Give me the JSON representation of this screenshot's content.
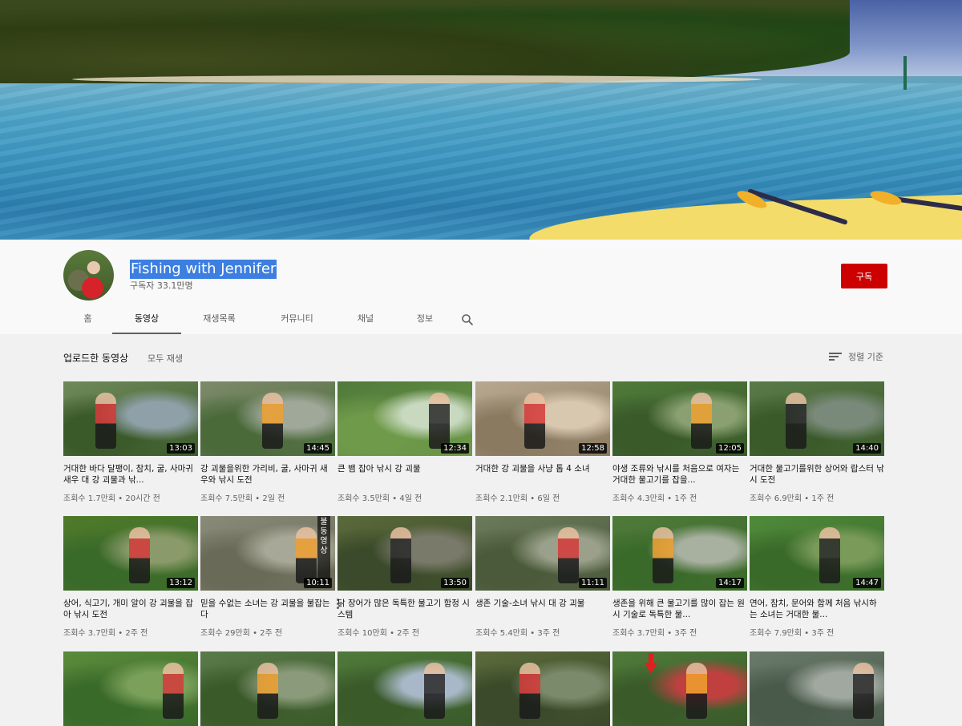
{
  "channel": {
    "name": "Fishing with Jennifer",
    "subscribers": "구독자 33.1만명",
    "subscribe_label": "구독"
  },
  "tabs": [
    {
      "label": "홈",
      "active": false
    },
    {
      "label": "동영상",
      "active": true
    },
    {
      "label": "재생목록",
      "active": false
    },
    {
      "label": "커뮤니티",
      "active": false
    },
    {
      "label": "채널",
      "active": false
    },
    {
      "label": "정보",
      "active": false
    }
  ],
  "section": {
    "title": "업로드한 동영상",
    "play_all": "모두 재생",
    "sort_label": "정렬 기준"
  },
  "videos": [
    {
      "title": "거대한 바다 달팽이, 참치, 굴, 사마귀 새우 대 강 괴물과 낚...",
      "meta": "조회수 1.7만회 • 20시간 전",
      "duration": "13:03",
      "colors": [
        "#6f8a5a",
        "#8fa0a8",
        "#3b5a2a"
      ]
    },
    {
      "title": "강 괴물을위한 가리비, 굴, 사마귀 새우와 낚시 도전",
      "meta": "조회수 7.5만회 • 2일 전",
      "duration": "14:45",
      "colors": [
        "#7d8a6a",
        "#a0a89a",
        "#4a6a3a"
      ]
    },
    {
      "title": "큰 뱀 잡아 낚시 강 괴물",
      "meta": "조회수 3.5만회 • 4일 전",
      "duration": "12:34",
      "colors": [
        "#4f7a3a",
        "#c9d9c0",
        "#6f9a4a"
      ]
    },
    {
      "title": "거대한 강 괴물을 사냥 톱 4 소녀",
      "meta": "조회수 2.1만회 • 6일 전",
      "duration": "12:58",
      "colors": [
        "#b8a890",
        "#d9c8b0",
        "#8a7a60"
      ]
    },
    {
      "title": "야생 조류와 낚시를 처음으로 여자는 거대한 물고기를 잡을...",
      "meta": "조회수 4.3만회 • 1주 전",
      "duration": "12:05",
      "colors": [
        "#4f7a3a",
        "#8aa070",
        "#3a5a2a"
      ]
    },
    {
      "title": "거대한 물고기를위한 상어와 랍스터 낚시 도전",
      "meta": "조회수 6.9만회 • 1주 전",
      "duration": "14:40",
      "colors": [
        "#5a7a4a",
        "#7a8a7a",
        "#3a5a2a"
      ]
    },
    {
      "title": "상어, 식고기, 개미 알이 강 괴물을 잡아 낚시 도전",
      "meta": "조회수 3.7만회 • 2주 전",
      "duration": "13:12",
      "colors": [
        "#4f7a2a",
        "#8a9a6a",
        "#3a6a2a"
      ]
    },
    {
      "title": "믿을 수없는 소녀는 강 괴물을 불잡는다",
      "meta": "조회수 29만회 • 2주 전",
      "duration": "10:11",
      "colors": [
        "#8a8a78",
        "#a8a898",
        "#6a6a58"
      ],
      "overlay_text": "불동영상"
    },
    {
      "title": "닭 장어가 많은 독특한 물고기 함정 시스템",
      "meta": "조회수 10만회 • 2주 전",
      "duration": "13:50",
      "colors": [
        "#5a6a3a",
        "#7a7a6a",
        "#3a4a2a"
      ]
    },
    {
      "title": "생존 기술-소녀 낚시 대 강 괴물",
      "meta": "조회수 5.4만회 • 3주 전",
      "duration": "11:11",
      "colors": [
        "#6a7a5a",
        "#9aa08a",
        "#4a5a3a"
      ]
    },
    {
      "title": "생존을 위해 큰 물고기를 많이 잡는 원시 기술로 독특한 물...",
      "meta": "조회수 3.7만회 • 3주 전",
      "duration": "14:17",
      "colors": [
        "#4f7a3a",
        "#a8b0a0",
        "#3a6a2a"
      ]
    },
    {
      "title": "연어, 참치, 문어와 함께 처음 낚시하는 소녀는 거대한 물...",
      "meta": "조회수 7.9만회 • 3주 전",
      "duration": "14:47",
      "colors": [
        "#4f8a3a",
        "#7a9a5a",
        "#3a6a2a"
      ]
    },
    {
      "title": "",
      "meta": "",
      "duration": "",
      "colors": [
        "#5a8a3a",
        "#7aa05a",
        "#3a6a2a"
      ]
    },
    {
      "title": "",
      "meta": "",
      "duration": "",
      "colors": [
        "#5a7a4a",
        "#8a9a7a",
        "#3a5a2a"
      ]
    },
    {
      "title": "",
      "meta": "",
      "duration": "",
      "colors": [
        "#4f7a3a",
        "#a8b8c8",
        "#3a5a2a"
      ]
    },
    {
      "title": "",
      "meta": "",
      "duration": "",
      "colors": [
        "#5a6a3a",
        "#7a8a6a",
        "#3a4a2a"
      ]
    },
    {
      "title": "",
      "meta": "",
      "duration": "",
      "colors": [
        "#4f7a3a",
        "#c04040",
        "#3a5a2a"
      ],
      "arrow": true
    },
    {
      "title": "",
      "meta": "",
      "duration": "",
      "colors": [
        "#6a7a6a",
        "#a0a8a0",
        "#4a5a4a"
      ]
    }
  ]
}
